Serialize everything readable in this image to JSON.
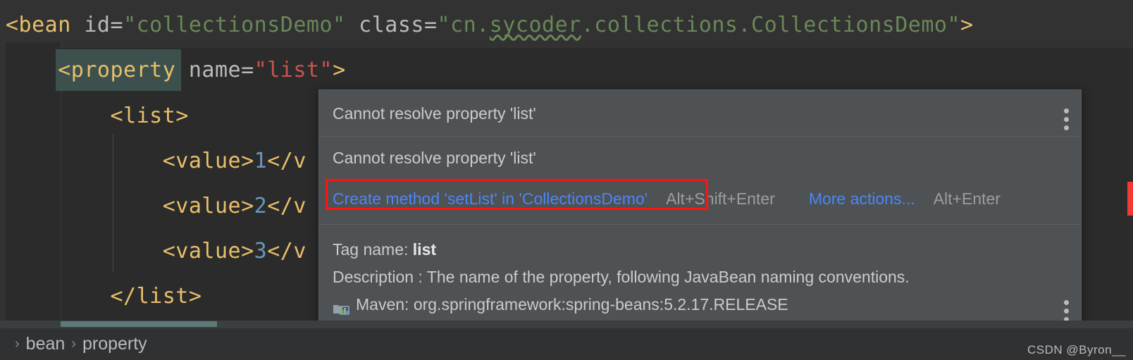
{
  "editor": {
    "lines": [
      {
        "id": "line-bean",
        "tokens": [
          {
            "t": "<bean ",
            "c": "tag"
          },
          {
            "t": "id=",
            "c": "attr"
          },
          {
            "t": "\"collectionsDemo\"",
            "c": "str"
          },
          {
            "t": " class=",
            "c": "attr"
          },
          {
            "t": "\"cn.",
            "c": "str"
          },
          {
            "t": "sycoder",
            "c": "str-squiggle"
          },
          {
            "t": ".collections.CollectionsDemo\"",
            "c": "str"
          },
          {
            "t": ">",
            "c": "tag"
          }
        ]
      },
      {
        "id": "line-property",
        "tokens": [
          {
            "t": "    <property ",
            "c": "tag"
          },
          {
            "t": "name=",
            "c": "attr"
          },
          {
            "t": "\"list\"",
            "c": "str-r"
          },
          {
            "t": ">",
            "c": "tag"
          }
        ]
      },
      {
        "id": "line-list-open",
        "tokens": [
          {
            "t": "        <list>",
            "c": "tag"
          }
        ]
      },
      {
        "id": "line-value-1",
        "tokens": [
          {
            "t": "            <value>",
            "c": "tag"
          },
          {
            "t": "1",
            "c": "num"
          },
          {
            "t": "</v",
            "c": "tag"
          }
        ]
      },
      {
        "id": "line-value-2",
        "tokens": [
          {
            "t": "            <value>",
            "c": "tag"
          },
          {
            "t": "2",
            "c": "num"
          },
          {
            "t": "</v",
            "c": "tag"
          }
        ]
      },
      {
        "id": "line-value-3",
        "tokens": [
          {
            "t": "            <value>",
            "c": "tag"
          },
          {
            "t": "3",
            "c": "num"
          },
          {
            "t": "</v",
            "c": "tag"
          }
        ]
      },
      {
        "id": "line-list-close",
        "tokens": [
          {
            "t": "        </list>",
            "c": "tag"
          }
        ]
      }
    ]
  },
  "popup": {
    "message_primary": "Cannot resolve property 'list'",
    "message_secondary": "Cannot resolve property 'list'",
    "primary_action": {
      "label": "Create method 'setList' in 'CollectionsDemo'",
      "shortcut": "Alt+Shift+Enter"
    },
    "secondary_action": {
      "label": "More actions...",
      "shortcut": "Alt+Enter"
    },
    "doc": {
      "tag_name_label": "Tag name:",
      "tag_name_value": "list",
      "description": "Description : The name of the property, following JavaBean naming conventions.",
      "maven_icon": "maven-bar-chart-icon",
      "maven": "Maven: org.springframework:spring-beans:5.2.17.RELEASE"
    },
    "menu_icon_top": "more-options-vertical-icon",
    "menu_icon_bottom": "more-options-vertical-icon"
  },
  "breadcrumb": {
    "chevron": "›",
    "items": [
      {
        "label": "bean"
      },
      {
        "label": "property"
      }
    ]
  },
  "watermark": "CSDN @Byron__",
  "colors": {
    "editor_bg": "#2b2b2b",
    "popup_bg": "#4e5254",
    "accent_link": "#4a86f7",
    "error_outline": "#ff1414",
    "error_stripe": "#f03a33",
    "tag": "#e8bf6a",
    "string": "#6a8759",
    "string_error": "#c75450",
    "number": "#6897bb",
    "selection_teal": "#3c514d"
  }
}
